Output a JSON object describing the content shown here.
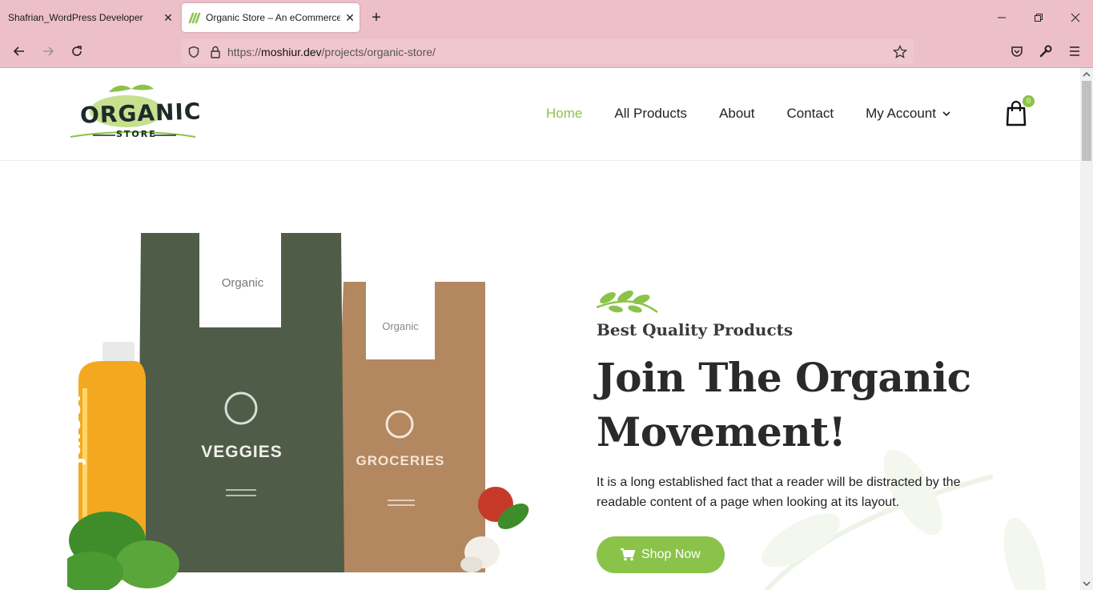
{
  "browser": {
    "tabs": [
      {
        "title": "Shafrian_WordPress Developer",
        "active": false
      },
      {
        "title": "Organic Store – An eCommerce",
        "active": true
      }
    ],
    "url_prefix": "https://",
    "url_host": "moshiur.dev",
    "url_path": "/projects/organic-store/"
  },
  "site": {
    "logo_text": "ORGANIC",
    "logo_sub": "STORE",
    "menu": {
      "home": "Home",
      "all_products": "All Products",
      "about": "About",
      "contact": "Contact",
      "my_account": "My Account"
    },
    "cart_count": "0"
  },
  "hero": {
    "bags": [
      "Organic",
      "VEGGIES",
      "Organic",
      "GROCERIES"
    ],
    "bottle_text": "juice.",
    "eyebrow": "Best Quality Products",
    "headline": "Join The Organic Movement!",
    "description": "It is a long established fact that a reader will be distracted by the readable content of a page when looking at its layout.",
    "button": "Shop Now"
  },
  "colors": {
    "accent": "#8bc34a",
    "chrome": "#edbfc9",
    "bag_dark": "#4f5c48",
    "bag_kraft": "#b3875f"
  }
}
